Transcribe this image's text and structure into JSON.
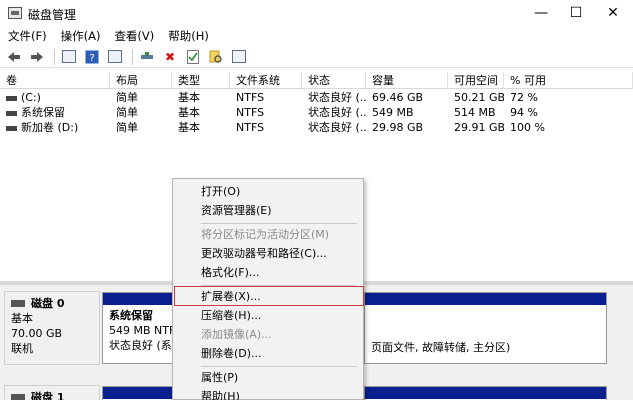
{
  "window": {
    "title": "磁盘管理",
    "minimize": "—",
    "maximize": "☐",
    "close": "✕"
  },
  "menu": {
    "file": "文件(F)",
    "action": "操作(A)",
    "view": "查看(V)",
    "help": "帮助(H)"
  },
  "toolbar": {
    "back_icon": "arrow-left-icon",
    "forward_icon": "arrow-right-icon",
    "delete_glyph": "✖"
  },
  "volumes": {
    "headers": [
      "卷",
      "布局",
      "类型",
      "文件系统",
      "状态",
      "容量",
      "可用空间",
      "% 可用"
    ],
    "rows": [
      [
        "(C:)",
        "简单",
        "基本",
        "NTFS",
        "状态良好 (...",
        "69.46 GB",
        "50.21 GB",
        "72 %"
      ],
      [
        "系统保留",
        "简单",
        "基本",
        "NTFS",
        "状态良好 (...",
        "549 MB",
        "514 MB",
        "94 %"
      ],
      [
        "新加卷 (D:)",
        "简单",
        "基本",
        "NTFS",
        "状态良好 (...",
        "29.98 GB",
        "29.91 GB",
        "100 %"
      ]
    ]
  },
  "disks": [
    {
      "name": "磁盘 0",
      "type": "基本",
      "size": "70.00 GB",
      "status": "联机",
      "partition": {
        "name": "系统保留",
        "detail": "549 MB NTFS",
        "status": "状态良好 (系统, 活动, 主分区)"
      },
      "partition2_status": "页面文件, 故障转储, 主分区)"
    },
    {
      "name": "磁盘 1"
    }
  ],
  "context_menu": {
    "open": "打开(O)",
    "explorer": "资源管理器(E)",
    "mark_active": "将分区标记为活动分区(M)",
    "change_letter": "更改驱动器号和路径(C)...",
    "format": "格式化(F)...",
    "extend": "扩展卷(X)...",
    "shrink": "压缩卷(H)...",
    "mirror": "添加镜像(A)...",
    "delete": "删除卷(D)...",
    "properties": "属性(P)",
    "help": "帮助(H)"
  },
  "colors": {
    "partition_bar": "#0b1f8f",
    "highlight": "#d23b3b"
  }
}
